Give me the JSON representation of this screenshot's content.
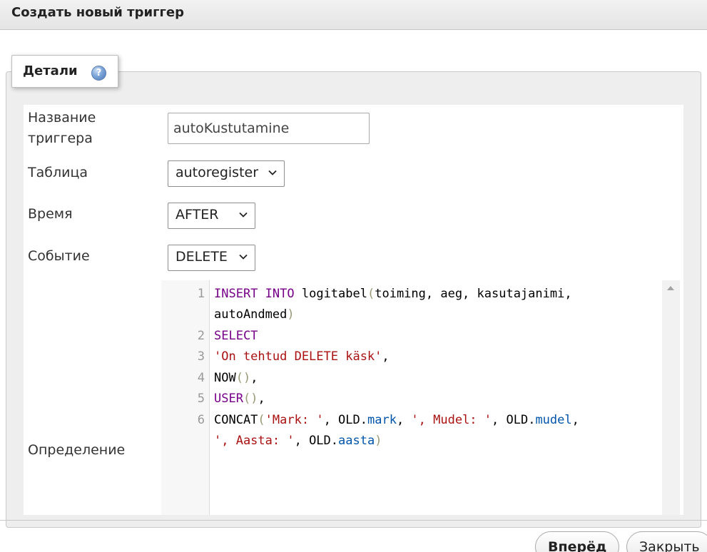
{
  "dialog": {
    "title": "Создать новый триггер"
  },
  "details": {
    "legend": "Детали",
    "help_icon": "help-icon"
  },
  "form": {
    "name_label_1": "Название",
    "name_label_2": "триггера",
    "name_value": "autoKustutamine",
    "table_label": "Таблица",
    "table_value": "autoregister",
    "time_label": "Время",
    "time_value": "AFTER",
    "event_label": "Событие",
    "event_value": "DELETE",
    "definition_label": "Определение"
  },
  "code": {
    "line_numbers": [
      "1",
      "2",
      "3",
      "4",
      "5",
      "6"
    ],
    "l1_kw_insert": "INSERT",
    "l1_kw_into": "INTO",
    "l1_rest": " logitabel",
    "l1_args": "toiming, aeg, kasutajanimi,",
    "l1b_args": "autoAndmed",
    "l2_kw": "SELECT",
    "l3_str": "'On tehtud DELETE käsk'",
    "l3_rest": ",",
    "l4_fn": "NOW",
    "l4_rest": ",",
    "l5_fn": "USER",
    "l5_rest": ",",
    "l6_fn": "CONCAT",
    "l6_s1": "'Mark: '",
    "l6_t1": ", OLD.",
    "l6_p1": "mark",
    "l6_t2": ", ",
    "l6_s2": "', Mudel: '",
    "l6_t3": ", OLD.",
    "l6_p2": "mudel",
    "l6_t4": ",",
    "l6b_s3": "', Aasta: '",
    "l6b_t5": ", OLD.",
    "l6b_p3": "aasta"
  },
  "buttons": {
    "forward": "Вперёд",
    "close": "Закрыть"
  }
}
